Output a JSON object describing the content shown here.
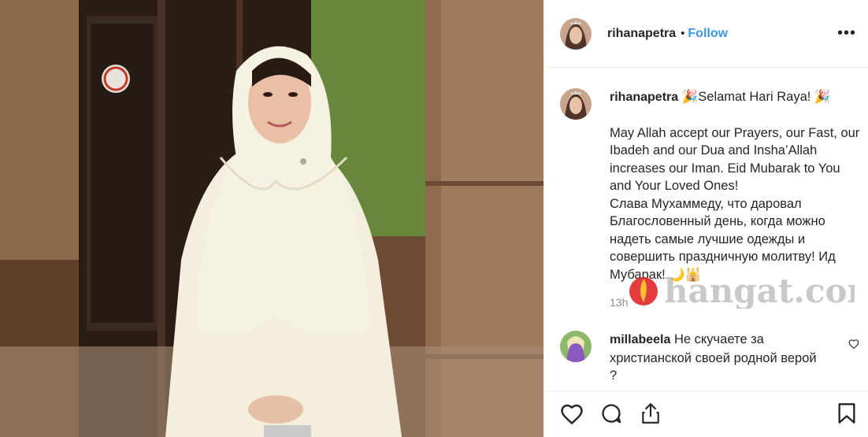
{
  "post": {
    "username": "rihanapetra",
    "dot": "•",
    "follow_label": "Follow",
    "more_label": "•••",
    "caption": {
      "username": "rihanapetra",
      "first_line": "🎉Selamat Hari Raya! 🎉",
      "paragraph1": "May Allah accept our Prayers, our Fast, our Ibadeh and our Dua and Insha’Allah increases our Iman. Eid Mubarak to You and Your Loved Ones!",
      "paragraph2": "Слава Мухаммеду, что даровал Благословенный день, когда можно надеть самые лучшие одежды и совершить праздничную молитву! Ид Мубарак! 🌙🕌"
    },
    "time_ago": "13h",
    "comment": {
      "username": "millabeela",
      "text": "Не скучаете за христианской своей родной верой ?"
    }
  },
  "watermark": {
    "brand_text": "hangat.com"
  },
  "icons": {
    "like": "heart-icon",
    "comment": "comment-icon",
    "share": "share-icon",
    "save": "bookmark-icon",
    "comment_like": "small-heart-icon",
    "more": "ellipsis-icon"
  },
  "colors": {
    "link": "#3897f0",
    "text": "#262626",
    "muted": "#8e8e8e",
    "border": "#efefef"
  }
}
